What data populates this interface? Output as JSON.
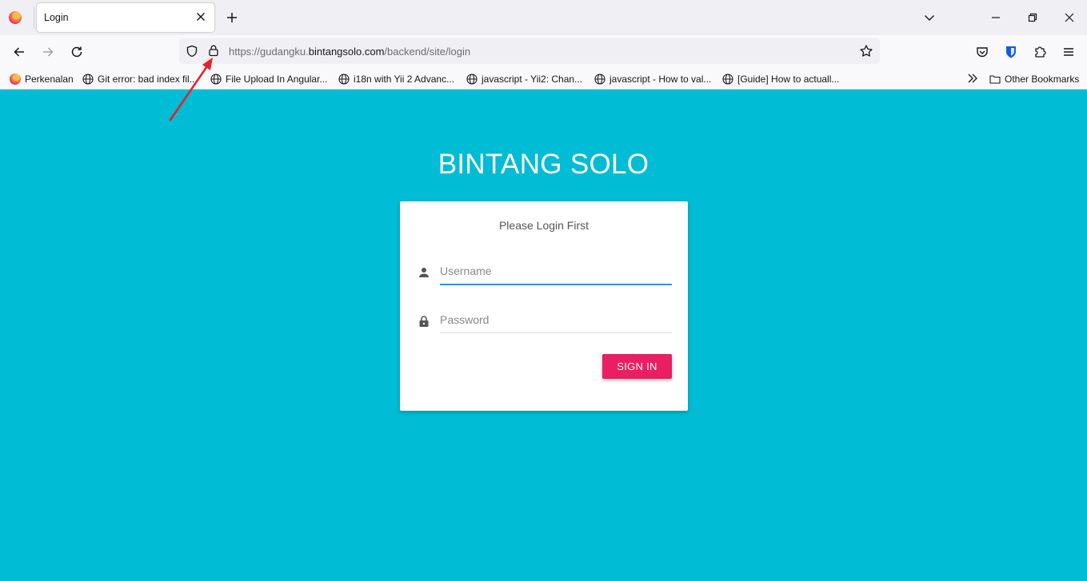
{
  "browser": {
    "tab": {
      "title": "Login"
    },
    "url": {
      "prefix": "https://gudangku.",
      "host": "bintangsolo.com",
      "path": "/backend/site/login"
    },
    "bookmarks": [
      {
        "label": "Perkenalan",
        "icon": "firefox-icon"
      },
      {
        "label": "Git error: bad index fil...",
        "icon": "globe-icon"
      },
      {
        "label": "File Upload In Angular...",
        "icon": "globe-icon"
      },
      {
        "label": "i18n with Yii 2 Advanc...",
        "icon": "globe-icon"
      },
      {
        "label": "javascript - Yii2: Chan...",
        "icon": "globe-icon"
      },
      {
        "label": "javascript - How to val...",
        "icon": "globe-icon"
      },
      {
        "label": "[Guide] How to actuall...",
        "icon": "globe-icon"
      }
    ],
    "other_bookmarks": "Other Bookmarks"
  },
  "page": {
    "brand": "BINTANG SOLO",
    "login_message": "Please Login First",
    "username_placeholder": "Username",
    "password_placeholder": "Password",
    "signin_label": "SIGN IN"
  },
  "colors": {
    "background": "#00bcd4",
    "primary_button": "#e91e63",
    "active_underline": "#2196f3",
    "annotation_arrow": "#e8202a"
  }
}
